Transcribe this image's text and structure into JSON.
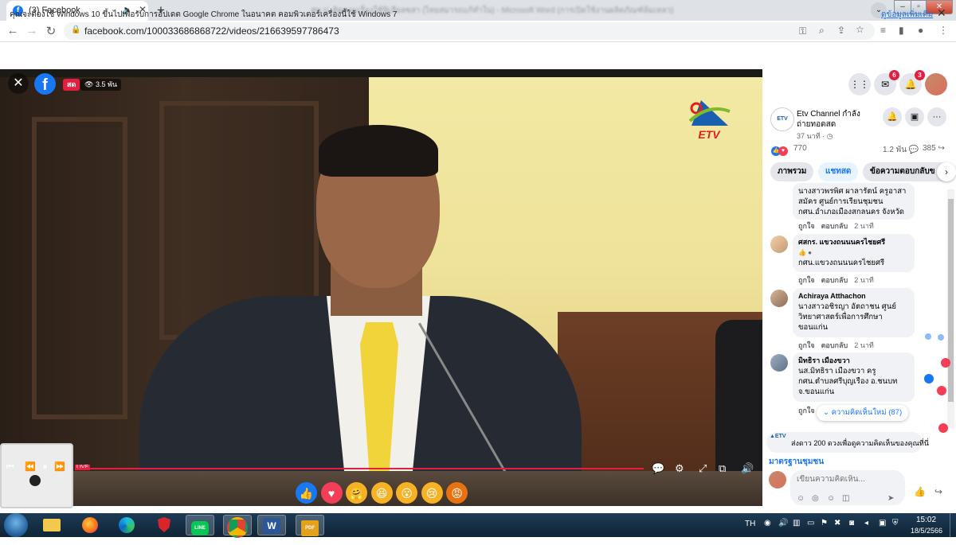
{
  "browser": {
    "tab_title": "(3) Facebook",
    "tab_favicon": "f",
    "tab_audio_icon": "🔈",
    "tab_close": "✕",
    "new_tab": "+",
    "window_title": "สพ.ป. ติดตามเรื่องใช้ฟิเลียลซสา (ไทยสมารถแก้ทำใน) - Microsoft Word (การเปิดใช้งานผลิตภัณฑ์ล้มเหลว)",
    "url": "facebook.com/100033686868722/videos/216639597786473",
    "info_text": "คุณจะต้องใช้ Windows 10 ขึ้นไปเพื่อรับการอัปเดต Google Chrome ในอนาคต คอมพิวเตอร์เครื่องนี้ใช้ Windows 7",
    "info_link": "ดูข้อมูลเพิ่มเติม",
    "info_close": "✕"
  },
  "video": {
    "live_label": "สด",
    "viewers": "3.5 พัน",
    "close": "✕",
    "logo_text": "ETV",
    "live_small": "LIVE",
    "progress": 1.0
  },
  "reactions": [
    {
      "name": "like",
      "glyph": "👍",
      "color": "#1877f2"
    },
    {
      "name": "love",
      "glyph": "♥",
      "color": "#f33e58"
    },
    {
      "name": "care",
      "glyph": "🤗",
      "color": "#f7b125"
    },
    {
      "name": "haha",
      "glyph": "😆",
      "color": "#f7b125"
    },
    {
      "name": "wow",
      "glyph": "😮",
      "color": "#f7b125"
    },
    {
      "name": "sad",
      "glyph": "😢",
      "color": "#f7b125"
    },
    {
      "name": "angry",
      "glyph": "😡",
      "color": "#e9710f"
    }
  ],
  "panel": {
    "messenger_badge": "6",
    "notif_badge": "3",
    "page_avatar_text": "ETV",
    "page_name": "Etv Channel กำลังถ่ายทอดสด",
    "page_time": "37 นาที · ◷",
    "like_count": "770",
    "comment_count": "1.2 พัน",
    "share_count": "385",
    "tabs": [
      "ภาพรวม",
      "แชทสด",
      "ข้อความตอบกลับข"
    ],
    "comments": [
      {
        "name": "",
        "text": "นางสาวพรพิศ ผาลารัตน์ ครูอาสาสมัคร ศูนย์การเรียนชุมชน กศน.อำเภอเมืองสกลนคร จังหวัดสกลนคร",
        "likes_label": "ถูกใจ",
        "reply_label": "ตอบกลับ",
        "time": "2 นาที"
      },
      {
        "name": "ศสกร. แขวงถนนนครไชยศรี",
        "text": "กศน.แขวงถนนนครไชยศรี",
        "likes_label": "ถูกใจ",
        "reply_label": "ตอบกลับ",
        "time": "2 นาที"
      },
      {
        "name": "Achiraya Atthachon",
        "text": "นางสาวอชิรญา อัตถาชน ศูนย์วิทยาศาสตร์เพื่อการศึกษาขอนแก่น",
        "likes_label": "ถูกใจ",
        "reply_label": "ตอบกลับ",
        "time": "2 นาที"
      },
      {
        "name": "มิทธิรา เมืองขวา",
        "text": "นส.มิทธิรา เมืองขวา ครู กศน.ตำบลศรีบุญเรือง อ.ชนบท จ.ขอนแก่น",
        "likes_label": "ถูกใจ",
        "reply_label": "",
        "time": ""
      }
    ],
    "new_comments": "ความคิดเห็นใหม่ (87)",
    "stars_text": "ส่งดาว 200 ดวงเพื่อดูความคิดเห็นของคุณที่นี่",
    "standard_label": "มาตรฐานชุมชน",
    "comment_placeholder": "เขียนความคิดเห็น..."
  },
  "taskbar": {
    "apps": [
      "explorer",
      "firefox",
      "edge",
      "shield",
      "line",
      "chrome",
      "word",
      "pdf"
    ],
    "line_label": "LINE",
    "word_label": "W",
    "pdf_label": "PDF",
    "lang": "TH",
    "time": "15:02",
    "date": "18/5/2566"
  }
}
